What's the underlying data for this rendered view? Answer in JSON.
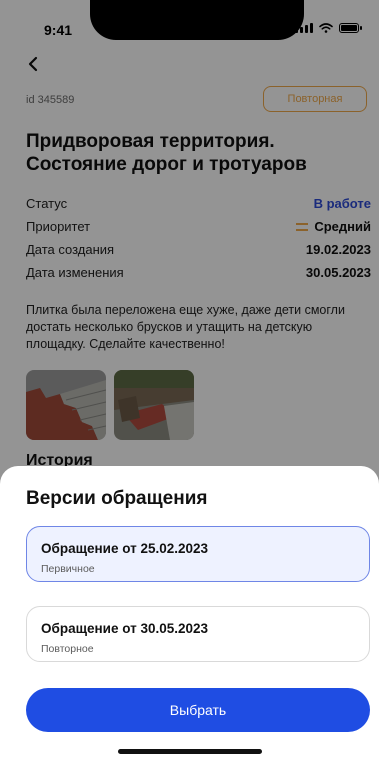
{
  "status_bar": {
    "time": "9:41"
  },
  "ticket": {
    "id": "id 345589",
    "badge": "Повторная",
    "title": "Придворовая территория. Состояние дорог и тротуаров",
    "fields": [
      {
        "label": "Статус",
        "value": "В работе"
      },
      {
        "label": "Приоритет",
        "value": "Средний"
      },
      {
        "label": "Дата создания",
        "value": "19.02.2023"
      },
      {
        "label": "Дата изменения",
        "value": "30.05.2023"
      }
    ],
    "description": "Плитка была переложена еще хуже, даже дети смогли достать несколько брусков и утащить на детскую площадку. Сделайте качественно!",
    "history_title": "История"
  },
  "sheet": {
    "title": "Версии обращения",
    "options": [
      {
        "title": "Обращение от 25.02.2023",
        "subtitle": "Первичное",
        "selected": true
      },
      {
        "title": "Обращение от 30.05.2023",
        "subtitle": "Повторное",
        "selected": false
      }
    ],
    "button_label": "Выбрать"
  },
  "colors": {
    "accent": "#1f4de3",
    "status_blue": "#2e4bd6",
    "badge_orange": "#f0a94a",
    "selected_bg": "#eef2ff"
  },
  "icons": [
    "back-chevron-icon",
    "signal-icon",
    "wifi-icon",
    "battery-icon",
    "priority-icon"
  ]
}
